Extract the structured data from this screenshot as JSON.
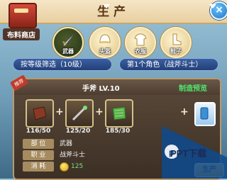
{
  "header": {
    "title": "生产",
    "close_label": "×"
  },
  "shop": {
    "label": "布料商店"
  },
  "categories": [
    {
      "label": "武器",
      "icon": "sword-icon",
      "active": true
    },
    {
      "label": "头盔",
      "icon": "helmet-icon",
      "active": false
    },
    {
      "label": "衣服",
      "icon": "armor-icon",
      "active": false
    },
    {
      "label": "鞋子",
      "icon": "boots-icon",
      "active": false
    }
  ],
  "filters": {
    "level": "按等级筛选（10级）",
    "character": "第1个角色（战斧斗士）"
  },
  "panel": {
    "badge": "推荐",
    "item_name": "手斧 LV.10",
    "preview_link": "制造预览",
    "materials": [
      {
        "count": "116/50",
        "icon": "leather-icon"
      },
      {
        "count": "125/20",
        "icon": "wand-icon"
      },
      {
        "count": "185/30",
        "icon": "cloth-icon"
      }
    ],
    "info": [
      {
        "key": "部 位",
        "value": "武器"
      },
      {
        "key": "职 业",
        "value": "战斧斗士"
      },
      {
        "key": "消 耗",
        "value": "125"
      }
    ],
    "make_button": "生产"
  },
  "watermark": {
    "text": "PPT下载"
  },
  "colors": {
    "accent_green": "#4ee66a",
    "panel_bg": "#3c2f24",
    "title_brown": "#5b3616"
  }
}
